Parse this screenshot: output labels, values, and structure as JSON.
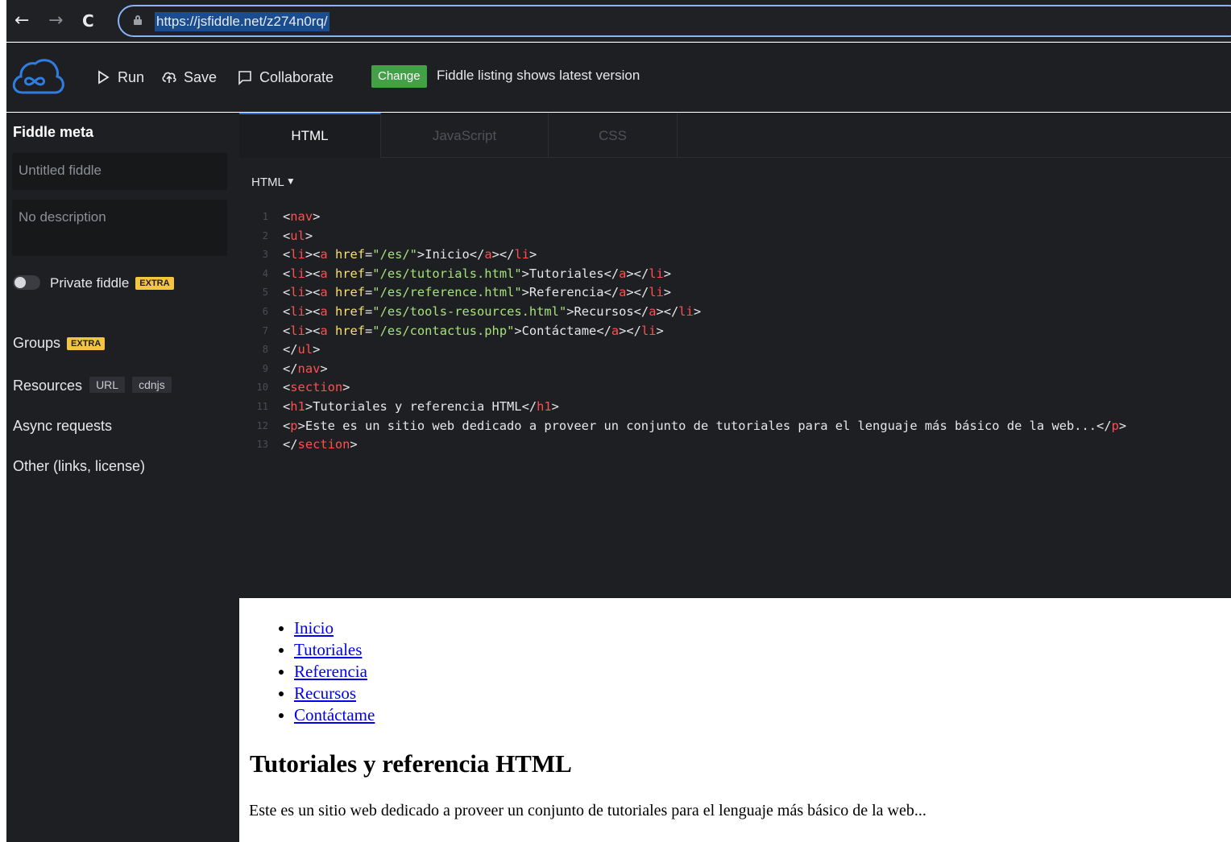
{
  "browser": {
    "back_icon": "←",
    "forward_icon": "→",
    "reload_icon": "C",
    "url": "https://jsfiddle.net/z274n0rq/"
  },
  "header": {
    "run_label": "Run",
    "save_label": "Save",
    "collaborate_label": "Collaborate",
    "change_badge": "Change",
    "change_text": "Fiddle listing shows latest version"
  },
  "sidebar": {
    "title": "Fiddle meta",
    "title_placeholder": "Untitled fiddle",
    "description_placeholder": "No description",
    "private_label": "Private fiddle",
    "extra_badge": "EXTRA",
    "groups_label": "Groups",
    "resources_label": "Resources",
    "resources_url": "URL",
    "resources_cdnjs": "cdnjs",
    "async_label": "Async requests",
    "other_label": "Other (links, license)"
  },
  "tabs": [
    {
      "label": "HTML",
      "active": true
    },
    {
      "label": "JavaScript",
      "active": false
    },
    {
      "label": "CSS",
      "active": false
    }
  ],
  "editor": {
    "language_label": "HTML",
    "dropdown_icon": "▼",
    "lines": [
      {
        "n": "1",
        "tokens": [
          [
            "pun",
            "<"
          ],
          [
            "tag",
            "nav"
          ],
          [
            "pun",
            ">"
          ]
        ]
      },
      {
        "n": "2",
        "tokens": [
          [
            "pun",
            "<"
          ],
          [
            "tag",
            "ul"
          ],
          [
            "pun",
            ">"
          ]
        ]
      },
      {
        "n": "3",
        "tokens": [
          [
            "pun",
            "<"
          ],
          [
            "tag",
            "li"
          ],
          [
            "pun",
            "><"
          ],
          [
            "tag",
            "a"
          ],
          [
            "pun",
            " "
          ],
          [
            "attr",
            "href"
          ],
          [
            "pun",
            "="
          ],
          [
            "str",
            "\"/es/\""
          ],
          [
            "pun",
            ">"
          ],
          [
            "txt",
            "Inicio"
          ],
          [
            "pun",
            "</"
          ],
          [
            "tag",
            "a"
          ],
          [
            "pun",
            "></"
          ],
          [
            "tag",
            "li"
          ],
          [
            "pun",
            ">"
          ]
        ]
      },
      {
        "n": "4",
        "tokens": [
          [
            "pun",
            "<"
          ],
          [
            "tag",
            "li"
          ],
          [
            "pun",
            "><"
          ],
          [
            "tag",
            "a"
          ],
          [
            "pun",
            " "
          ],
          [
            "attr",
            "href"
          ],
          [
            "pun",
            "="
          ],
          [
            "str",
            "\"/es/tutorials.html\""
          ],
          [
            "pun",
            ">"
          ],
          [
            "txt",
            "Tutoriales"
          ],
          [
            "pun",
            "</"
          ],
          [
            "tag",
            "a"
          ],
          [
            "pun",
            "></"
          ],
          [
            "tag",
            "li"
          ],
          [
            "pun",
            ">"
          ]
        ]
      },
      {
        "n": "5",
        "tokens": [
          [
            "pun",
            "<"
          ],
          [
            "tag",
            "li"
          ],
          [
            "pun",
            "><"
          ],
          [
            "tag",
            "a"
          ],
          [
            "pun",
            " "
          ],
          [
            "attr",
            "href"
          ],
          [
            "pun",
            "="
          ],
          [
            "str",
            "\"/es/reference.html\""
          ],
          [
            "pun",
            ">"
          ],
          [
            "txt",
            "Referencia"
          ],
          [
            "pun",
            "</"
          ],
          [
            "tag",
            "a"
          ],
          [
            "pun",
            "></"
          ],
          [
            "tag",
            "li"
          ],
          [
            "pun",
            ">"
          ]
        ]
      },
      {
        "n": "6",
        "tokens": [
          [
            "pun",
            "<"
          ],
          [
            "tag",
            "li"
          ],
          [
            "pun",
            "><"
          ],
          [
            "tag",
            "a"
          ],
          [
            "pun",
            " "
          ],
          [
            "attr",
            "href"
          ],
          [
            "pun",
            "="
          ],
          [
            "str",
            "\"/es/tools-resources.html\""
          ],
          [
            "pun",
            ">"
          ],
          [
            "txt",
            "Recursos"
          ],
          [
            "pun",
            "</"
          ],
          [
            "tag",
            "a"
          ],
          [
            "pun",
            "></"
          ],
          [
            "tag",
            "li"
          ],
          [
            "pun",
            ">"
          ]
        ]
      },
      {
        "n": "7",
        "tokens": [
          [
            "pun",
            "<"
          ],
          [
            "tag",
            "li"
          ],
          [
            "pun",
            "><"
          ],
          [
            "tag",
            "a"
          ],
          [
            "pun",
            " "
          ],
          [
            "attr",
            "href"
          ],
          [
            "pun",
            "="
          ],
          [
            "str",
            "\"/es/contactus.php\""
          ],
          [
            "pun",
            ">"
          ],
          [
            "txt",
            "Contáctame"
          ],
          [
            "pun",
            "</"
          ],
          [
            "tag",
            "a"
          ],
          [
            "pun",
            "></"
          ],
          [
            "tag",
            "li"
          ],
          [
            "pun",
            ">"
          ]
        ]
      },
      {
        "n": "8",
        "tokens": [
          [
            "pun",
            "</"
          ],
          [
            "tag",
            "ul"
          ],
          [
            "pun",
            ">"
          ]
        ]
      },
      {
        "n": "9",
        "tokens": [
          [
            "pun",
            "</"
          ],
          [
            "tag",
            "nav"
          ],
          [
            "pun",
            ">"
          ]
        ]
      },
      {
        "n": "10",
        "tokens": [
          [
            "pun",
            "<"
          ],
          [
            "tag",
            "section"
          ],
          [
            "pun",
            ">"
          ]
        ]
      },
      {
        "n": "11",
        "tokens": [
          [
            "pun",
            "<"
          ],
          [
            "tag",
            "h1"
          ],
          [
            "pun",
            ">"
          ],
          [
            "txt",
            "Tutoriales y referencia HTML"
          ],
          [
            "pun",
            "</"
          ],
          [
            "tag",
            "h1"
          ],
          [
            "pun",
            ">"
          ]
        ]
      },
      {
        "n": "12",
        "tokens": [
          [
            "pun",
            "<"
          ],
          [
            "tag",
            "p"
          ],
          [
            "pun",
            ">"
          ],
          [
            "txt",
            "Este es un sitio web dedicado a proveer un conjunto de tutoriales para el lenguaje más básico de la web..."
          ],
          [
            "pun",
            "</"
          ],
          [
            "tag",
            "p"
          ],
          [
            "pun",
            ">"
          ]
        ]
      },
      {
        "n": "13",
        "tokens": [
          [
            "pun",
            "</"
          ],
          [
            "tag",
            "section"
          ],
          [
            "pun",
            ">"
          ]
        ]
      }
    ]
  },
  "result": {
    "links": [
      "Inicio",
      "Tutoriales",
      "Referencia",
      "Recursos",
      "Contáctame"
    ],
    "heading": "Tutoriales y referencia HTML",
    "paragraph": "Este es un sitio web dedicado a proveer un conjunto de tutoriales para el lenguaje más básico de la web..."
  }
}
